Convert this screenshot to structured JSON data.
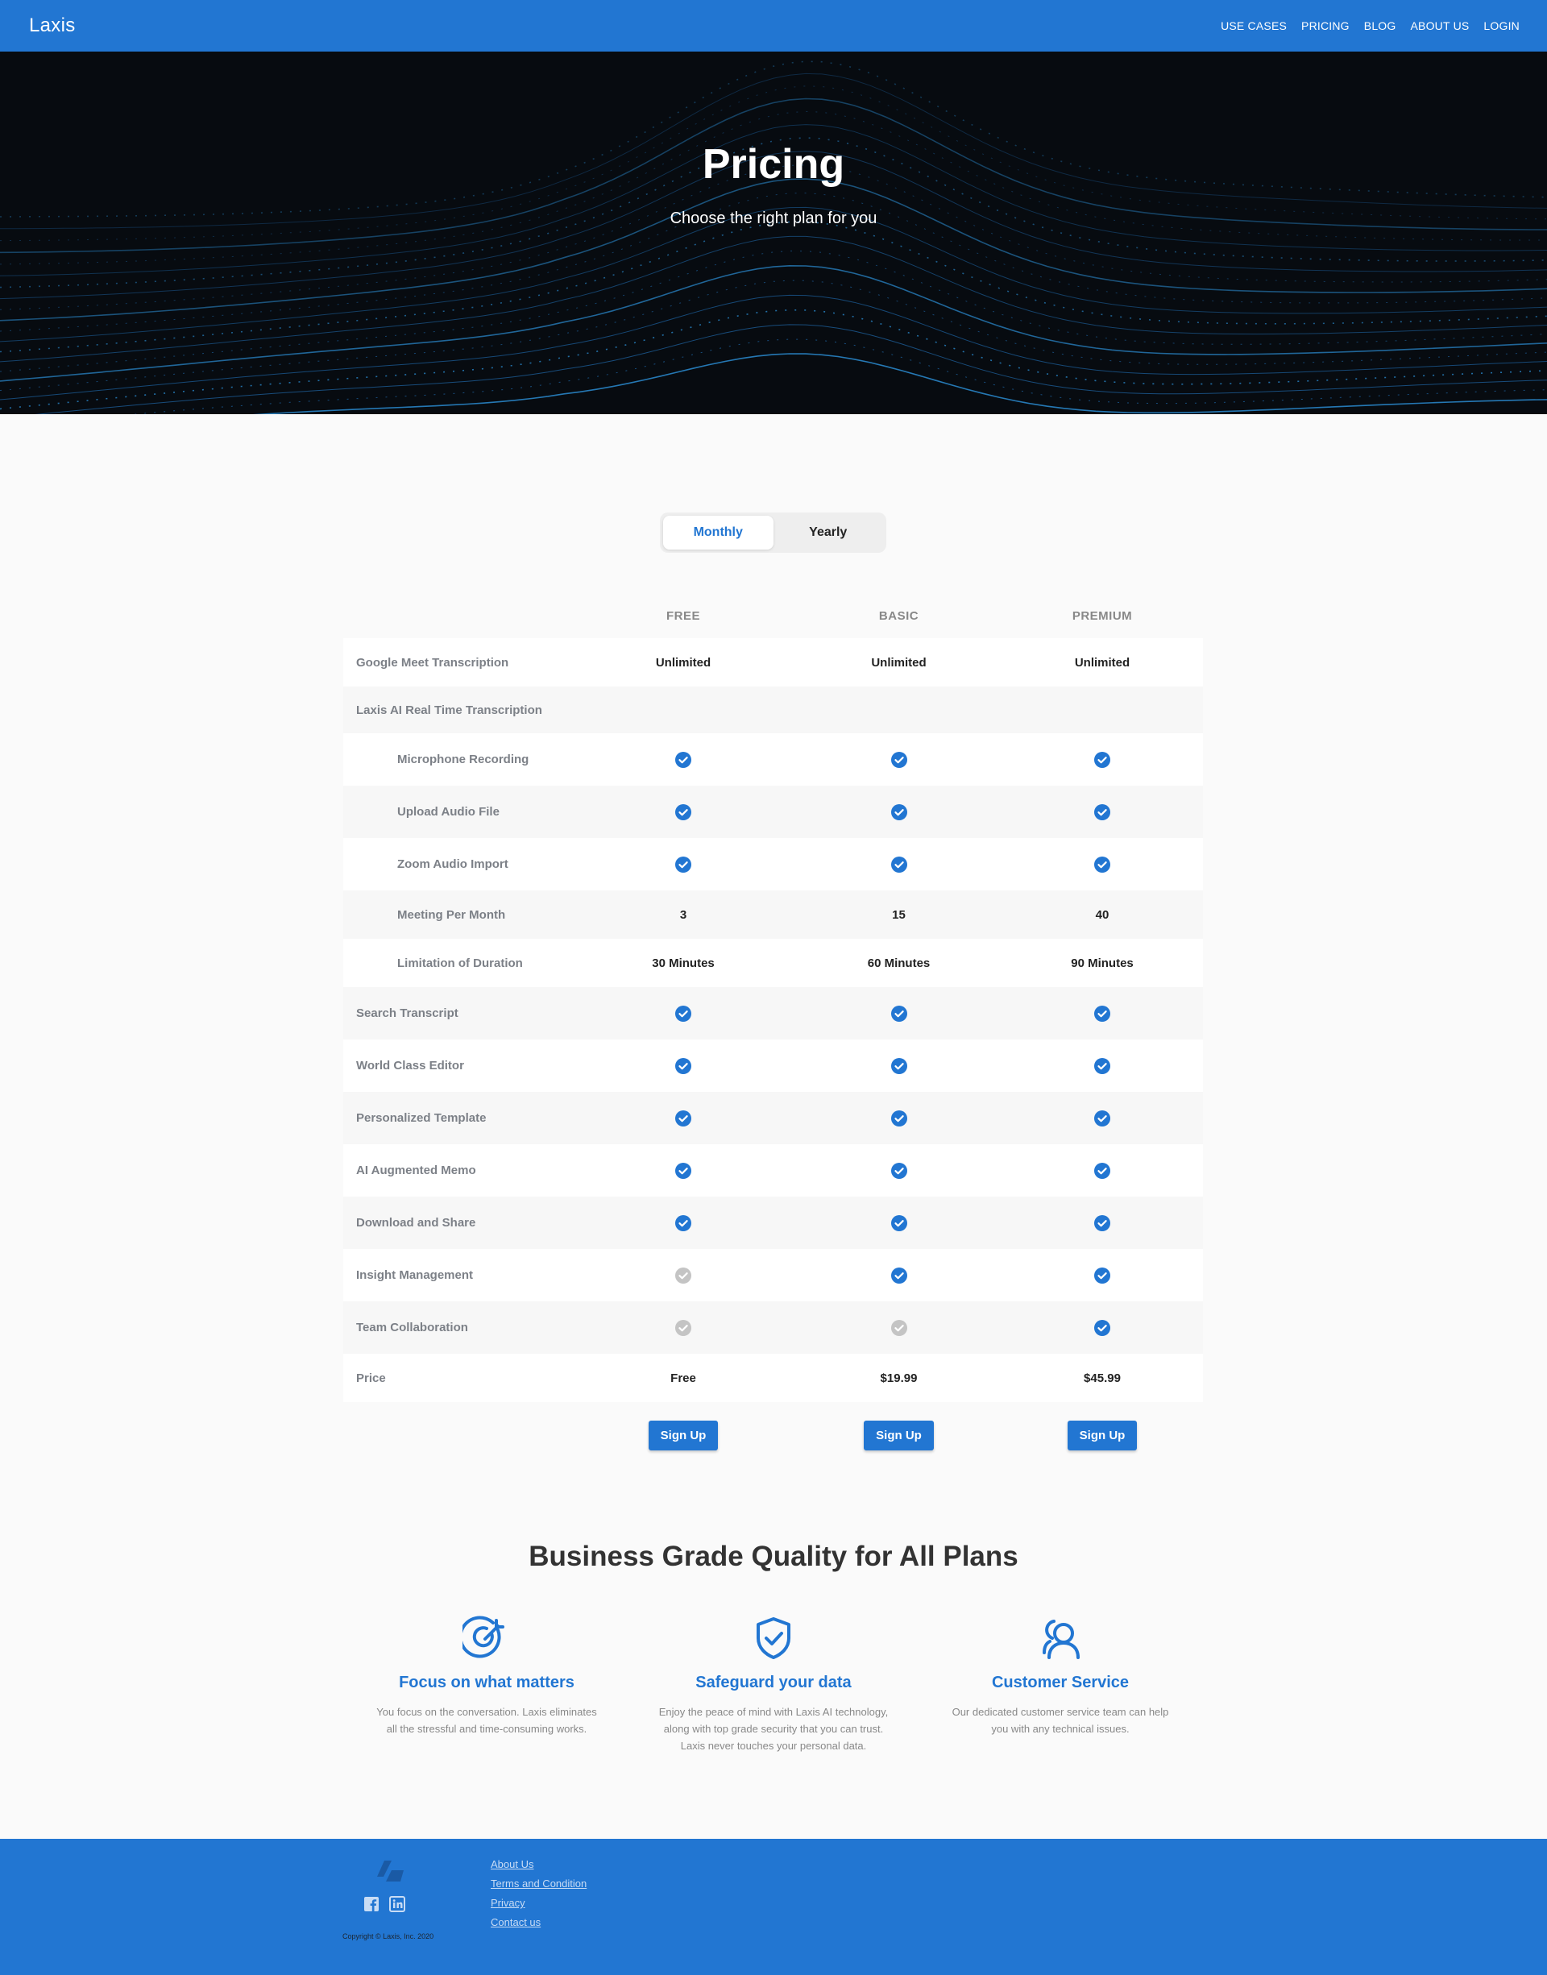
{
  "nav": {
    "brand": "Laxis",
    "links": [
      "USE CASES",
      "PRICING",
      "BLOG",
      "ABOUT US",
      "LOGIN"
    ]
  },
  "hero": {
    "title": "Pricing",
    "subtitle": "Choose the right plan for you"
  },
  "billing_toggle": {
    "options": [
      "Monthly",
      "Yearly"
    ],
    "selected": "Monthly"
  },
  "plans": [
    "FREE",
    "BASIC",
    "PREMIUM"
  ],
  "features": [
    {
      "label": "Google Meet Transcription",
      "indent": false,
      "values": [
        "Unlimited",
        "Unlimited",
        "Unlimited"
      ]
    },
    {
      "label": "Laxis AI Real Time Transcription",
      "indent": false,
      "values": [
        "",
        "",
        ""
      ]
    },
    {
      "label": "Microphone Recording",
      "indent": true,
      "values": [
        "check",
        "check",
        "check"
      ]
    },
    {
      "label": "Upload Audio File",
      "indent": true,
      "values": [
        "check",
        "check",
        "check"
      ]
    },
    {
      "label": "Zoom Audio Import",
      "indent": true,
      "values": [
        "check",
        "check",
        "check"
      ]
    },
    {
      "label": "Meeting Per Month",
      "indent": true,
      "values": [
        "3",
        "15",
        "40"
      ]
    },
    {
      "label": "Limitation of Duration",
      "indent": true,
      "values": [
        "30 Minutes",
        "60 Minutes",
        "90 Minutes"
      ]
    },
    {
      "label": "Search Transcript",
      "indent": false,
      "values": [
        "check",
        "check",
        "check"
      ]
    },
    {
      "label": "World Class Editor",
      "indent": false,
      "values": [
        "check",
        "check",
        "check"
      ]
    },
    {
      "label": "Personalized Template",
      "indent": false,
      "values": [
        "check",
        "check",
        "check"
      ]
    },
    {
      "label": "AI Augmented Memo",
      "indent": false,
      "values": [
        "check",
        "check",
        "check"
      ]
    },
    {
      "label": "Download and Share",
      "indent": false,
      "values": [
        "check",
        "check",
        "check"
      ]
    },
    {
      "label": "Insight Management",
      "indent": false,
      "values": [
        "disabled",
        "check",
        "check"
      ]
    },
    {
      "label": "Team Collaboration",
      "indent": false,
      "values": [
        "disabled",
        "disabled",
        "check"
      ]
    },
    {
      "label": "Price",
      "indent": false,
      "values": [
        "Free",
        "$19.99",
        "$45.99"
      ]
    }
  ],
  "signup_label": "Sign Up",
  "quality": {
    "title": "Business Grade Quality for All Plans",
    "items": [
      {
        "icon": "target-icon",
        "title": "Focus on what matters",
        "text": "You focus on the conversation. Laxis eliminates all the stressful and time-consuming works."
      },
      {
        "icon": "shield-check-icon",
        "title": "Safeguard your data",
        "text": "Enjoy the peace of mind with Laxis AI technology, along with top grade security that you can trust. Laxis never touches your personal data."
      },
      {
        "icon": "users-icon",
        "title": "Customer Service",
        "text": "Our dedicated customer service team can help you with any technical issues."
      }
    ]
  },
  "footer": {
    "copyright": "Copyright © Laxis, Inc. 2020",
    "links": [
      "About Us",
      "Terms and Condition",
      "Privacy",
      "Contact us"
    ],
    "social": [
      "facebook-icon",
      "linkedin-icon"
    ]
  },
  "colors": {
    "brand": "#2276d2",
    "check": "#2276d2",
    "check_disabled": "#c4c4c4"
  }
}
